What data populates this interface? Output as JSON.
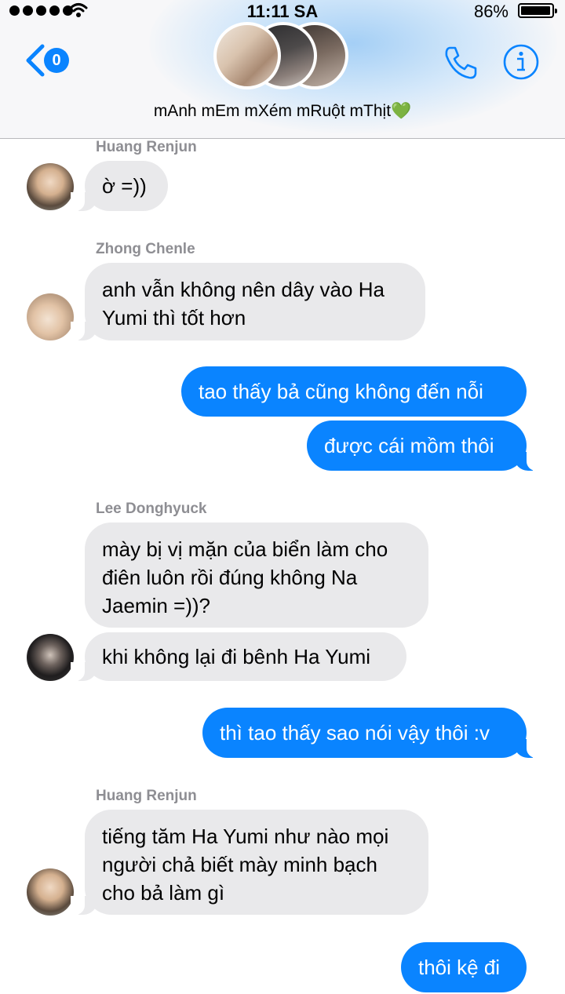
{
  "status_bar": {
    "time": "11:11 SA",
    "battery_percent": "86%",
    "battery_level": 0.86
  },
  "header": {
    "unread_count": "0",
    "group_name": "mAnh mEm mXém mRuột mThịt💚",
    "icons": [
      "chevron-left-icon",
      "phone-icon",
      "info-icon"
    ]
  },
  "colors": {
    "accent": "#0a84ff",
    "incoming_bubble": "#e9e9eb",
    "outgoing_bubble": "#0a84ff",
    "sender_name": "#8e8e93"
  },
  "messages": [
    {
      "sender": "Huang Renjun",
      "text": "ờ =))"
    },
    {
      "sender": "Zhong Chenle",
      "text_lines": [
        "anh vẫn không nên dây vào Ha",
        "Yumi thì tốt hơn"
      ]
    },
    {
      "sender": "me",
      "text": "tao thấy bả cũng không đến nỗi"
    },
    {
      "sender": "me",
      "text": "được cái mồm thôi"
    },
    {
      "sender": "Lee Donghyuck",
      "text_lines": [
        "mày bị vị mặn của biển làm cho",
        "điên luôn rồi đúng không Na",
        "Jaemin =))?"
      ]
    },
    {
      "sender": "Lee Donghyuck",
      "text": "khi không lại đi bênh Ha Yumi"
    },
    {
      "sender": "me",
      "text": "thì tao thấy sao nói vậy thôi :v"
    },
    {
      "sender": "Huang Renjun",
      "text_lines": [
        "tiếng tăm Ha Yumi như nào mọi",
        "người chả biết mày minh bạch",
        "cho bả làm gì"
      ]
    },
    {
      "sender": "me",
      "text": "thôi kệ đi"
    }
  ]
}
